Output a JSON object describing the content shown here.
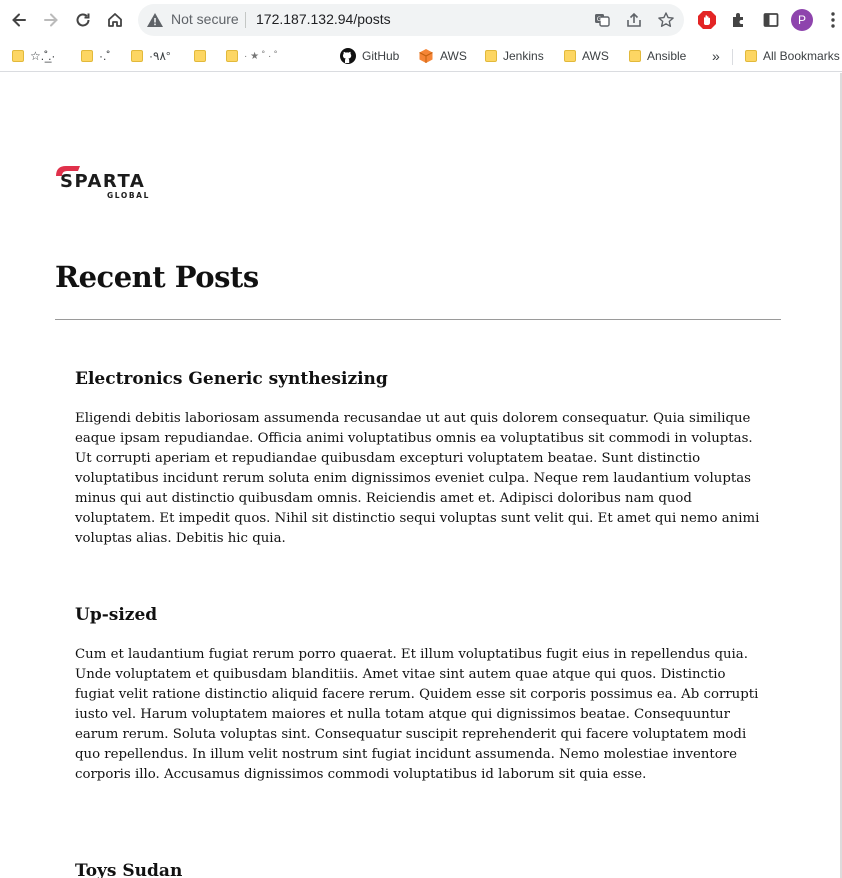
{
  "browser": {
    "security_text": "Not secure",
    "url": "172.187.132.94/posts",
    "profile_initial": "P",
    "accent": "#8e44ad"
  },
  "bookmarks": {
    "items": [
      {
        "label": "☆.˚̲.·",
        "icon": "folder-icon"
      },
      {
        "label": "·.˚",
        "icon": "folder-icon"
      },
      {
        "label": "·٩٨°",
        "icon": "folder-icon"
      },
      {
        "label": "",
        "icon": "folder-icon"
      },
      {
        "label": "·  ★ ˚ · ˚",
        "icon": "folder-icon"
      },
      {
        "label": "GitHub",
        "icon": "github-icon"
      },
      {
        "label": "AWS",
        "icon": "aws-cube-icon"
      },
      {
        "label": "Jenkins",
        "icon": "folder-icon"
      },
      {
        "label": "AWS",
        "icon": "folder-icon"
      },
      {
        "label": "Ansible",
        "icon": "folder-icon"
      }
    ],
    "overflow": "»",
    "all_bookmarks": "All Bookmarks"
  },
  "page": {
    "logo": {
      "main": "SPARTA",
      "sub": "GLOBAL",
      "accent": "#e0314b"
    },
    "title": "Recent Posts",
    "posts": [
      {
        "title": "Electronics Generic synthesizing",
        "body": "Eligendi debitis laboriosam assumenda recusandae ut aut quis dolorem consequatur. Quia similique eaque ipsam repudiandae. Officia animi voluptatibus omnis ea voluptatibus sit commodi in voluptas. Ut corrupti aperiam et repudiandae quibusdam excepturi voluptatem beatae. Sunt distinctio voluptatibus incidunt rerum soluta enim dignissimos eveniet culpa. Neque rem laudantium voluptas minus qui aut distinctio quibusdam omnis. Reiciendis amet et. Adipisci doloribus nam quod voluptatem. Et impedit quos. Nihil sit distinctio sequi voluptas sunt velit qui. Et amet qui nemo animi voluptas alias. Debitis hic quia."
      },
      {
        "title": "Up-sized",
        "body": "Cum et laudantium fugiat rerum porro quaerat. Et illum voluptatibus fugit eius in repellendus quia. Unde voluptatem et quibusdam blanditiis. Amet vitae sint autem quae atque qui quos. Distinctio fugiat velit ratione distinctio aliquid facere rerum. Quidem esse sit corporis possimus ea. Ab corrupti iusto vel. Harum voluptatem maiores et nulla totam atque qui dignissimos beatae. Consequuntur earum rerum. Soluta voluptas sint. Consequatur suscipit reprehenderit qui facere voluptatem modi quo repellendus. In illum velit nostrum sint fugiat incidunt assumenda. Nemo molestiae inventore corporis illo. Accusamus dignissimos commodi voluptatibus id laborum sit quia esse."
      },
      {
        "title": "Toys Sudan",
        "body": ""
      }
    ]
  }
}
